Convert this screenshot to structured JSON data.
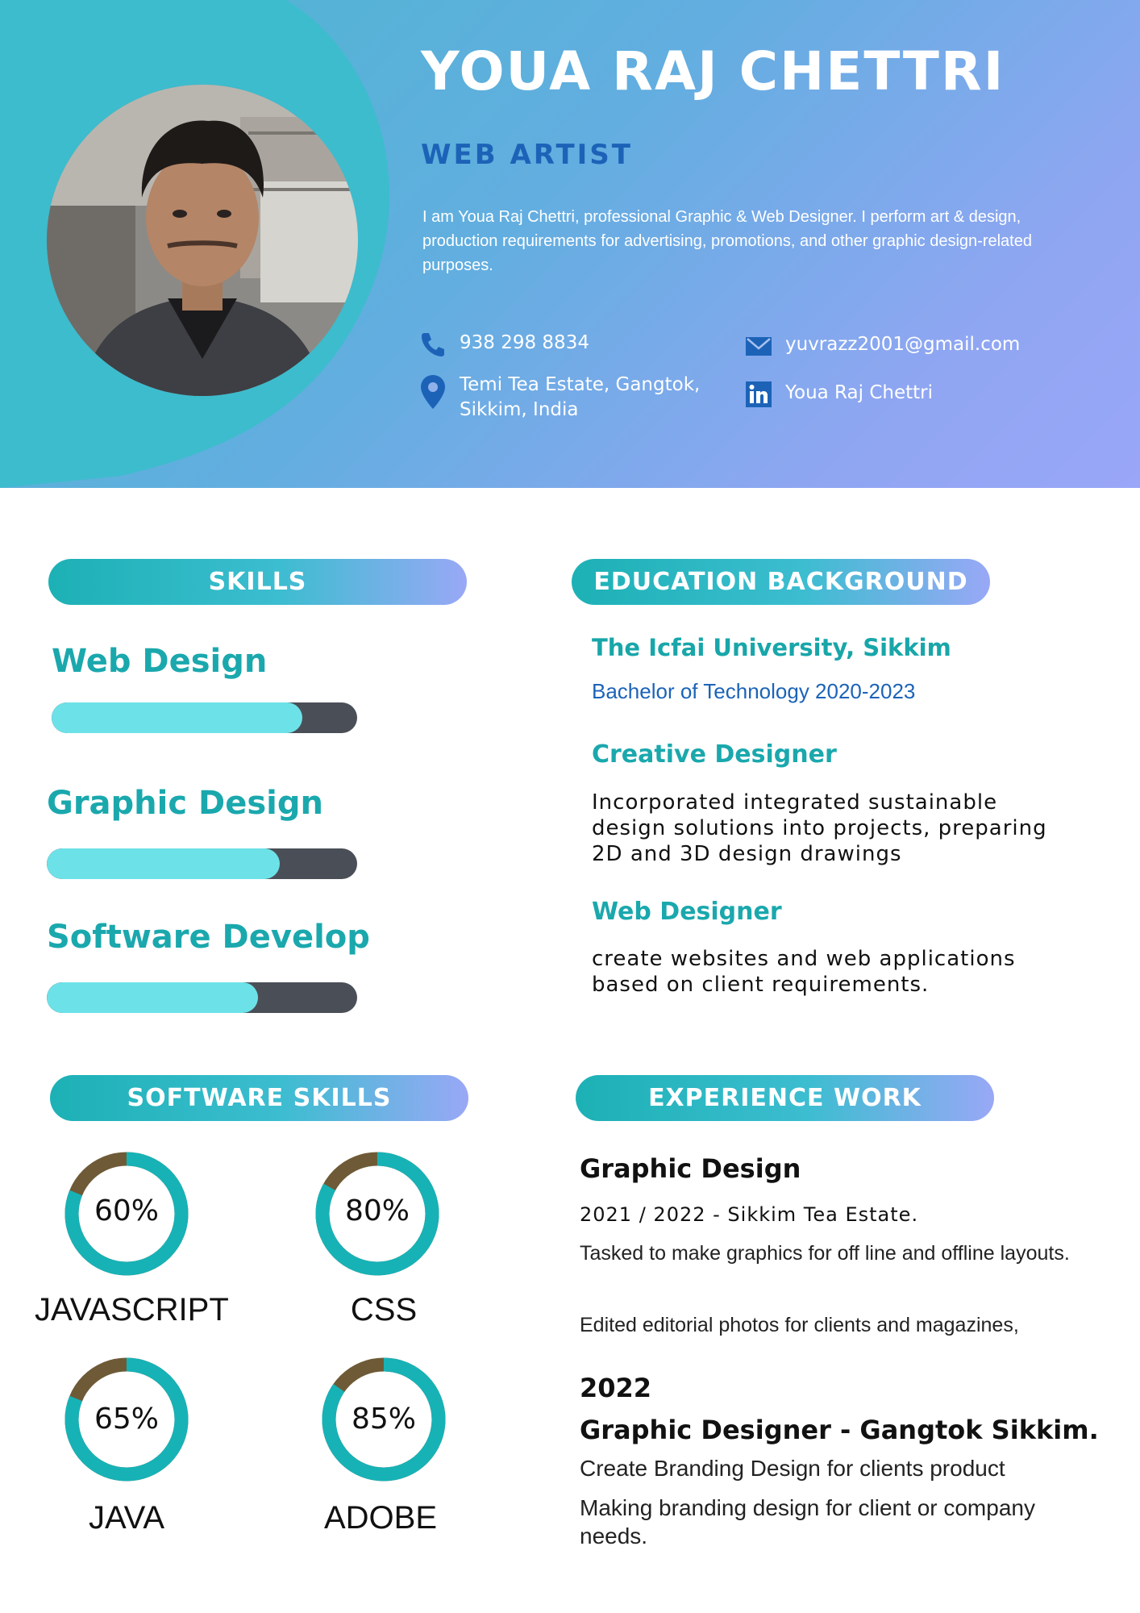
{
  "header": {
    "name": "YOUA RAJ CHETTRI",
    "role": "WEB ARTIST",
    "bio": "I am Youa Raj Chettri, professional Graphic & Web Designer. I perform art & design, production requirements for advertising, promotions, and other graphic design-related purposes."
  },
  "contact": {
    "phone": "938 298 8834",
    "address_line1": "Temi Tea Estate, Gangtok,",
    "address_line2": "Sikkim, India",
    "email": "yuvrazz2001@gmail.com",
    "linkedin": "Youa Raj Chettri",
    "icons": [
      "phone-icon",
      "location-pin-icon",
      "mail-icon",
      "linkedin-icon"
    ]
  },
  "skills": {
    "title": "SKILLS",
    "items": [
      {
        "label": "Web Design",
        "level": 0.82
      },
      {
        "label": "Graphic Design",
        "level": 0.75
      },
      {
        "label": "Software Develop",
        "level": 0.68
      }
    ]
  },
  "software_skills": {
    "title": "SOFTWARE SKILLS",
    "items": [
      {
        "label": "JAVASCRIPT",
        "percent": "60%"
      },
      {
        "label": "CSS",
        "percent": "80%"
      },
      {
        "label": "JAVA",
        "percent": "65%"
      },
      {
        "label": "ADOBE",
        "percent": "85%"
      }
    ]
  },
  "education": {
    "title": "EDUCATION BACKGROUND",
    "school": "The Icfai University, Sikkim",
    "degree": "Bachelor of Technology 2020-2023",
    "entries": [
      {
        "heading": "Creative Designer",
        "body": "Incorporated integrated sustainable design solutions into projects, preparing 2D and 3D design drawings"
      },
      {
        "heading": "Web Designer",
        "body": "create websites and web applications based on client requirements."
      }
    ]
  },
  "experience": {
    "title": "EXPERIENCE WORK",
    "job1_title": "Graphic Design",
    "job1_sub": "2021 / 2022 - Sikkim Tea Estate.",
    "job1_body1": "Tasked to make graphics for off line and offline layouts.",
    "job1_body2": "Edited editorial photos for clients and magazines,",
    "job2_year": "2022",
    "job2_title": "Graphic Designer - Gangtok Sikkim.",
    "job2_body1": "Create Branding Design for clients product",
    "job2_body2": "Making branding design for client or company needs."
  },
  "colors": {
    "accent_teal": "#1aa8ad",
    "accent_blue": "#1c63b8",
    "bar_fill": "#6ce2e8",
    "bar_track": "#4a4f57",
    "ring_main": "#17b2b6",
    "ring_rest": "#6e5a36"
  }
}
